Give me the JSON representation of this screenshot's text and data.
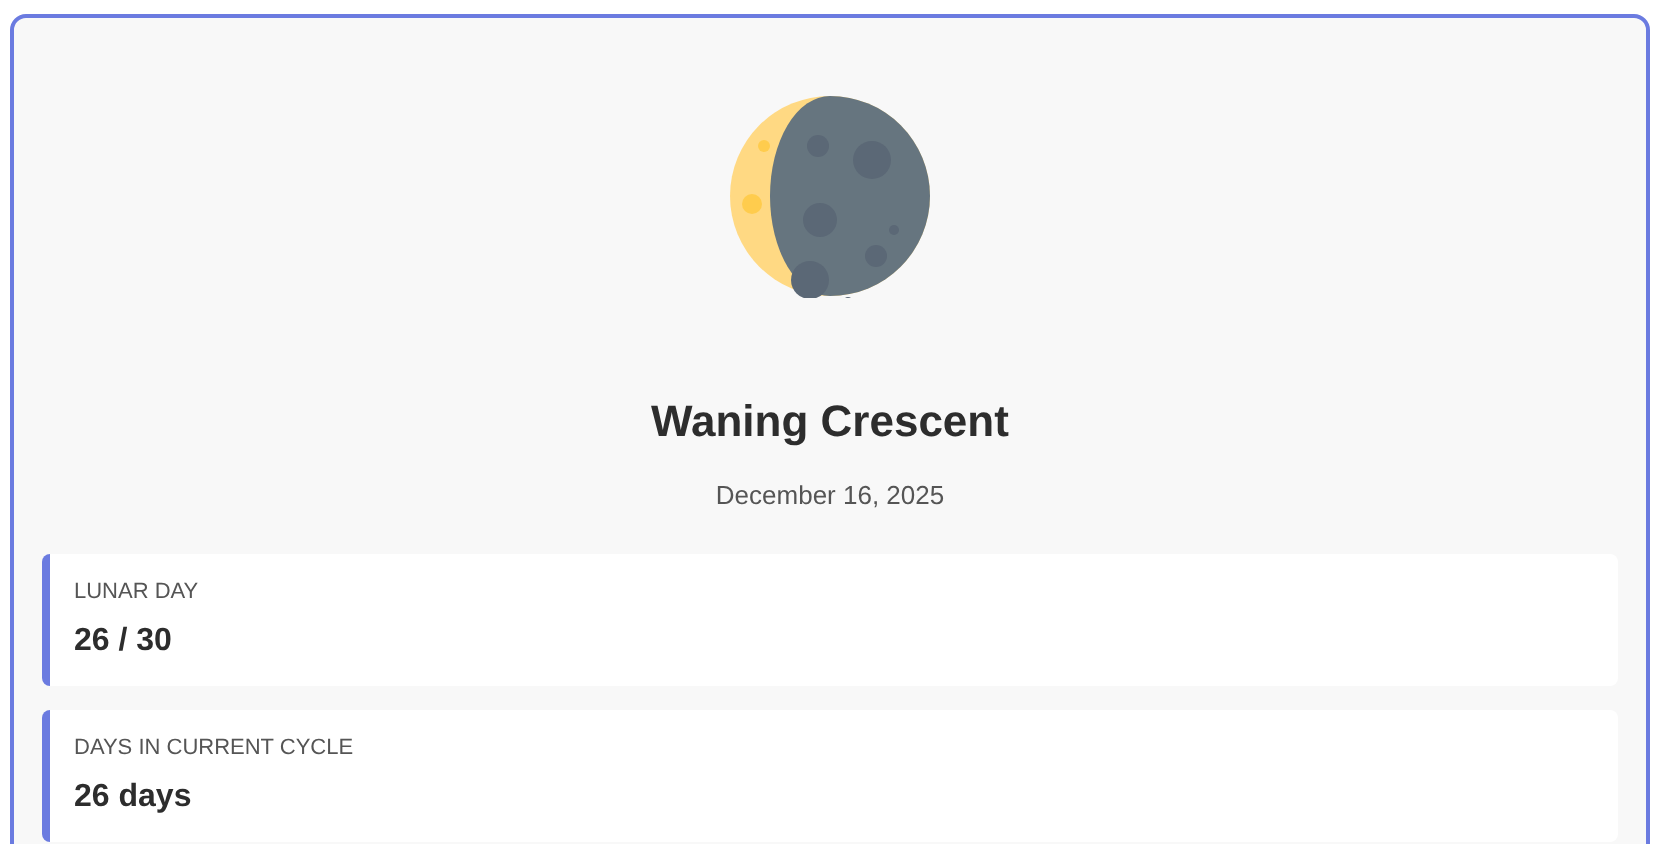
{
  "phase": {
    "name": "Waning Crescent",
    "date": "December 16, 2025"
  },
  "stats": [
    {
      "label": "LUNAR DAY",
      "value": "26 / 30"
    },
    {
      "label": "DAYS IN CURRENT CYCLE",
      "value": "26 days"
    }
  ]
}
